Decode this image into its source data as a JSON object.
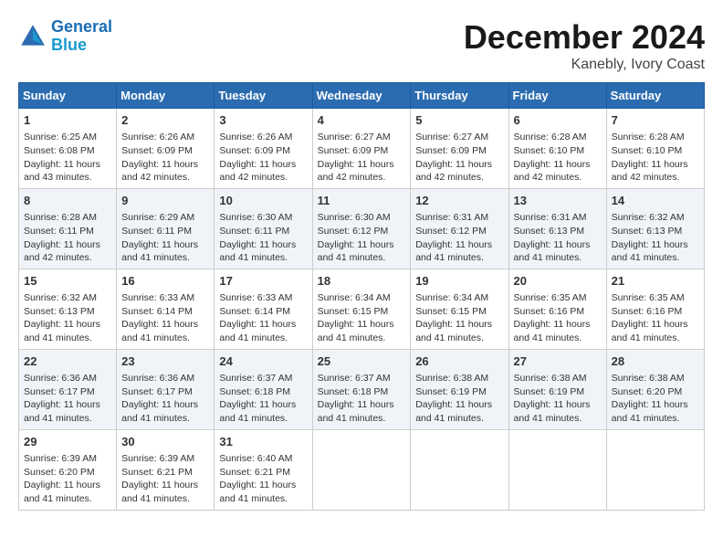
{
  "header": {
    "logo_line1": "General",
    "logo_line2": "Blue",
    "month_title": "December 2024",
    "location": "Kanebly, Ivory Coast"
  },
  "days_of_week": [
    "Sunday",
    "Monday",
    "Tuesday",
    "Wednesday",
    "Thursday",
    "Friday",
    "Saturday"
  ],
  "weeks": [
    [
      {
        "day": "1",
        "sunrise": "6:25 AM",
        "sunset": "6:08 PM",
        "daylight": "11 hours and 43 minutes."
      },
      {
        "day": "2",
        "sunrise": "6:26 AM",
        "sunset": "6:09 PM",
        "daylight": "11 hours and 42 minutes."
      },
      {
        "day": "3",
        "sunrise": "6:26 AM",
        "sunset": "6:09 PM",
        "daylight": "11 hours and 42 minutes."
      },
      {
        "day": "4",
        "sunrise": "6:27 AM",
        "sunset": "6:09 PM",
        "daylight": "11 hours and 42 minutes."
      },
      {
        "day": "5",
        "sunrise": "6:27 AM",
        "sunset": "6:09 PM",
        "daylight": "11 hours and 42 minutes."
      },
      {
        "day": "6",
        "sunrise": "6:28 AM",
        "sunset": "6:10 PM",
        "daylight": "11 hours and 42 minutes."
      },
      {
        "day": "7",
        "sunrise": "6:28 AM",
        "sunset": "6:10 PM",
        "daylight": "11 hours and 42 minutes."
      }
    ],
    [
      {
        "day": "8",
        "sunrise": "6:28 AM",
        "sunset": "6:11 PM",
        "daylight": "11 hours and 42 minutes."
      },
      {
        "day": "9",
        "sunrise": "6:29 AM",
        "sunset": "6:11 PM",
        "daylight": "11 hours and 41 minutes."
      },
      {
        "day": "10",
        "sunrise": "6:30 AM",
        "sunset": "6:11 PM",
        "daylight": "11 hours and 41 minutes."
      },
      {
        "day": "11",
        "sunrise": "6:30 AM",
        "sunset": "6:12 PM",
        "daylight": "11 hours and 41 minutes."
      },
      {
        "day": "12",
        "sunrise": "6:31 AM",
        "sunset": "6:12 PM",
        "daylight": "11 hours and 41 minutes."
      },
      {
        "day": "13",
        "sunrise": "6:31 AM",
        "sunset": "6:13 PM",
        "daylight": "11 hours and 41 minutes."
      },
      {
        "day": "14",
        "sunrise": "6:32 AM",
        "sunset": "6:13 PM",
        "daylight": "11 hours and 41 minutes."
      }
    ],
    [
      {
        "day": "15",
        "sunrise": "6:32 AM",
        "sunset": "6:13 PM",
        "daylight": "11 hours and 41 minutes."
      },
      {
        "day": "16",
        "sunrise": "6:33 AM",
        "sunset": "6:14 PM",
        "daylight": "11 hours and 41 minutes."
      },
      {
        "day": "17",
        "sunrise": "6:33 AM",
        "sunset": "6:14 PM",
        "daylight": "11 hours and 41 minutes."
      },
      {
        "day": "18",
        "sunrise": "6:34 AM",
        "sunset": "6:15 PM",
        "daylight": "11 hours and 41 minutes."
      },
      {
        "day": "19",
        "sunrise": "6:34 AM",
        "sunset": "6:15 PM",
        "daylight": "11 hours and 41 minutes."
      },
      {
        "day": "20",
        "sunrise": "6:35 AM",
        "sunset": "6:16 PM",
        "daylight": "11 hours and 41 minutes."
      },
      {
        "day": "21",
        "sunrise": "6:35 AM",
        "sunset": "6:16 PM",
        "daylight": "11 hours and 41 minutes."
      }
    ],
    [
      {
        "day": "22",
        "sunrise": "6:36 AM",
        "sunset": "6:17 PM",
        "daylight": "11 hours and 41 minutes."
      },
      {
        "day": "23",
        "sunrise": "6:36 AM",
        "sunset": "6:17 PM",
        "daylight": "11 hours and 41 minutes."
      },
      {
        "day": "24",
        "sunrise": "6:37 AM",
        "sunset": "6:18 PM",
        "daylight": "11 hours and 41 minutes."
      },
      {
        "day": "25",
        "sunrise": "6:37 AM",
        "sunset": "6:18 PM",
        "daylight": "11 hours and 41 minutes."
      },
      {
        "day": "26",
        "sunrise": "6:38 AM",
        "sunset": "6:19 PM",
        "daylight": "11 hours and 41 minutes."
      },
      {
        "day": "27",
        "sunrise": "6:38 AM",
        "sunset": "6:19 PM",
        "daylight": "11 hours and 41 minutes."
      },
      {
        "day": "28",
        "sunrise": "6:38 AM",
        "sunset": "6:20 PM",
        "daylight": "11 hours and 41 minutes."
      }
    ],
    [
      {
        "day": "29",
        "sunrise": "6:39 AM",
        "sunset": "6:20 PM",
        "daylight": "11 hours and 41 minutes."
      },
      {
        "day": "30",
        "sunrise": "6:39 AM",
        "sunset": "6:21 PM",
        "daylight": "11 hours and 41 minutes."
      },
      {
        "day": "31",
        "sunrise": "6:40 AM",
        "sunset": "6:21 PM",
        "daylight": "11 hours and 41 minutes."
      },
      null,
      null,
      null,
      null
    ]
  ]
}
